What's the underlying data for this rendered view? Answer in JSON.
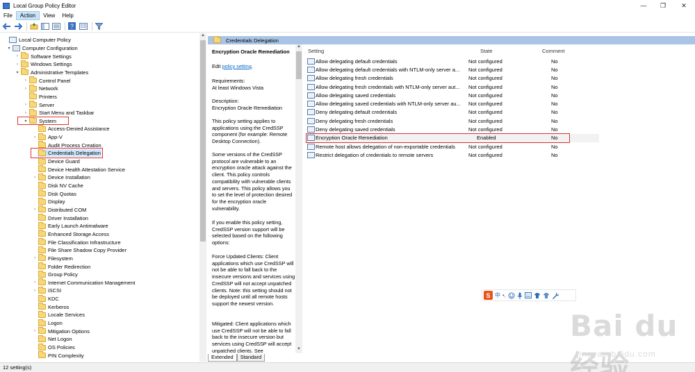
{
  "window": {
    "title": "Local Group Policy Editor",
    "min": "—",
    "max": "❐",
    "close": "✕"
  },
  "menu": [
    "File",
    "Action",
    "View",
    "Help"
  ],
  "tree": {
    "root": "Local Computer Policy",
    "computer_config": "Computer Configuration",
    "items": [
      {
        "label": "Software Settings"
      },
      {
        "label": "Windows Settings"
      },
      {
        "label": "Administrative Templates"
      },
      {
        "label": "Control Panel"
      },
      {
        "label": "Network"
      },
      {
        "label": "Printers"
      },
      {
        "label": "Server"
      },
      {
        "label": "Start Menu and Taskbar"
      },
      {
        "label": "System"
      },
      {
        "label": "Access-Denied Assistance"
      },
      {
        "label": "App-V"
      },
      {
        "label": "Audit Process Creation"
      },
      {
        "label": "Credentials Delegation"
      },
      {
        "label": "Device Guard"
      },
      {
        "label": "Device Health Attestation Service"
      },
      {
        "label": "Device Installation"
      },
      {
        "label": "Disk NV Cache"
      },
      {
        "label": "Disk Quotas"
      },
      {
        "label": "Display"
      },
      {
        "label": "Distributed COM"
      },
      {
        "label": "Driver Installation"
      },
      {
        "label": "Early Launch Antimalware"
      },
      {
        "label": "Enhanced Storage Access"
      },
      {
        "label": "File Classification Infrastructure"
      },
      {
        "label": "File Share Shadow Copy Provider"
      },
      {
        "label": "Filesystem"
      },
      {
        "label": "Folder Redirection"
      },
      {
        "label": "Group Policy"
      },
      {
        "label": "Internet Communication Management"
      },
      {
        "label": "iSCSI"
      },
      {
        "label": "KDC"
      },
      {
        "label": "Kerberos"
      },
      {
        "label": "Locale Services"
      },
      {
        "label": "Logon"
      },
      {
        "label": "Mitigation Options"
      },
      {
        "label": "Net Logon"
      },
      {
        "label": "OS Policies"
      },
      {
        "label": "PIN Complexity"
      }
    ]
  },
  "pane_header": "Credentials Delegation",
  "description": {
    "title": "Encryption Oracle Remediation",
    "edit_prefix": "Edit ",
    "edit_link": "policy setting",
    "edit_suffix": ".",
    "requirements": "Requirements:\nAt least Windows Vista",
    "desc_label": "Description:\nEncryption Oracle Remediation",
    "p1": "This policy setting applies to applications using the CredSSP component (for example: Remote Desktop Connection).",
    "p2": "Some versions of the CredSSP protocol are vulnerable to an encryption oracle attack against the client.  This policy controls compatibility with vulnerable clients and servers.  This policy allows you to set the level of protection desired for the encryption oracle vulnerability.",
    "p3": "If you enable this policy setting, CredSSP version support will be selected based on the following options:",
    "p4": "Force Updated Clients: Client applications which use CredSSP will not be able to fall back to the insecure versions and services using CredSSP will not accept unpatched clients. Note: this setting should not be deployed until all remote hosts support the newest version.",
    "p5": "Mitigated: Client applications which use CredSSP will not be able to fall back to the insecure version but services using CredSSP will accept unpatched clients. See"
  },
  "tabs": [
    "Extended",
    "Standard"
  ],
  "list": {
    "headers": {
      "setting": "Setting",
      "state": "State",
      "comment": "Comment"
    },
    "rows": [
      {
        "setting": "Allow delegating default credentials",
        "state": "Not configured",
        "comment": "No"
      },
      {
        "setting": "Allow delegating default credentials with NTLM-only server a...",
        "state": "Not configured",
        "comment": "No"
      },
      {
        "setting": "Allow delegating fresh credentials",
        "state": "Not configured",
        "comment": "No"
      },
      {
        "setting": "Allow delegating fresh credentials with NTLM-only server aut...",
        "state": "Not configured",
        "comment": "No"
      },
      {
        "setting": "Allow delegating saved credentials",
        "state": "Not configured",
        "comment": "No"
      },
      {
        "setting": "Allow delegating saved credentials with NTLM-only server au...",
        "state": "Not configured",
        "comment": "No"
      },
      {
        "setting": "Deny delegating default credentials",
        "state": "Not configured",
        "comment": "No"
      },
      {
        "setting": "Deny delegating fresh credentials",
        "state": "Not configured",
        "comment": "No"
      },
      {
        "setting": "Deny delegating saved credentials",
        "state": "Not configured",
        "comment": "No"
      },
      {
        "setting": "Encryption Oracle Remediation",
        "state": "Enabled",
        "comment": "No"
      },
      {
        "setting": "Remote host allows delegation of non-exportable credentials",
        "state": "Not configured",
        "comment": "No"
      },
      {
        "setting": "Restrict delegation of credentials to remote servers",
        "state": "Not configured",
        "comment": "No"
      }
    ]
  },
  "status": "12 setting(s)",
  "ime": {
    "logo": "S",
    "lang": "中",
    "punct": "•,"
  },
  "watermark": {
    "text": "Bai du 经验",
    "sub": "jingyan.baidu.com"
  },
  "colors": {
    "header_bar": "#a9c4e4",
    "highlight": "#e03030",
    "selection": "#cce8ff"
  }
}
